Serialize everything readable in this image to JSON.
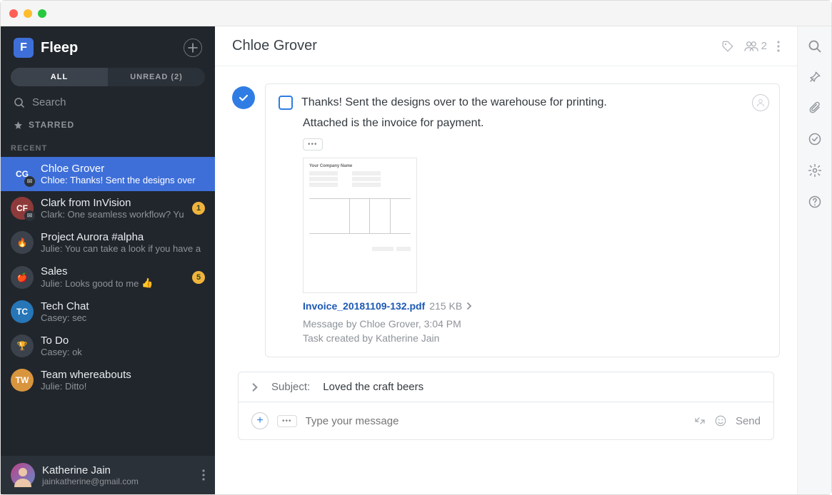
{
  "brand": {
    "name": "Fleep",
    "glyph": "F"
  },
  "tabs": {
    "all": "ALL",
    "unread": "UNREAD (2)"
  },
  "search": {
    "placeholder": "Search"
  },
  "starred_label": "STARRED",
  "recent_label": "RECENT",
  "conversations": [
    {
      "initials": "CG",
      "name": "Chloe Grover",
      "preview": "Chloe: Thanks! Sent the designs over",
      "color": "#3e6fd9",
      "selected": true,
      "mail_sub": true
    },
    {
      "initials": "CF",
      "name": "Clark from InVision",
      "preview": "Clark: One seamless workflow? Yu",
      "color": "#8f3a3a",
      "badge": "1",
      "mail_sub": true
    },
    {
      "initials": "🔥",
      "name": "Project Aurora #alpha",
      "preview": "Julie: You can take a look if you have a",
      "color": "#3b424b"
    },
    {
      "initials": "🍎",
      "name": "Sales",
      "preview": "Julie: Looks good to me",
      "color": "#3b424b",
      "badge": "5",
      "thumb": true
    },
    {
      "initials": "TC",
      "name": "Tech Chat",
      "preview": "Casey: sec",
      "color": "#2676b8"
    },
    {
      "initials": "🏆",
      "name": "To Do",
      "preview": "Casey: ok",
      "color": "#3b424b"
    },
    {
      "initials": "TW",
      "name": "Team whereabouts",
      "preview": "Julie: Ditto!",
      "color": "#d9953e"
    }
  ],
  "me": {
    "name": "Katherine Jain",
    "email": "jainkatherine@gmail.com"
  },
  "chat": {
    "title": "Chloe Grover",
    "member_count": "2",
    "message_line1": "Thanks! Sent the designs over to the warehouse for printing.",
    "message_line2": "Attached is the invoice for payment.",
    "invoice_label": "Your Company Name",
    "file_name": "Invoice_20181109-132.pdf",
    "file_size": "215 KB",
    "meta1": "Message by Chloe Grover, 3:04 PM",
    "meta2": "Task created by Katherine Jain"
  },
  "compose": {
    "subject_label": "Subject:",
    "subject_value": "Loved the craft beers",
    "placeholder": "Type your message",
    "send": "Send"
  }
}
